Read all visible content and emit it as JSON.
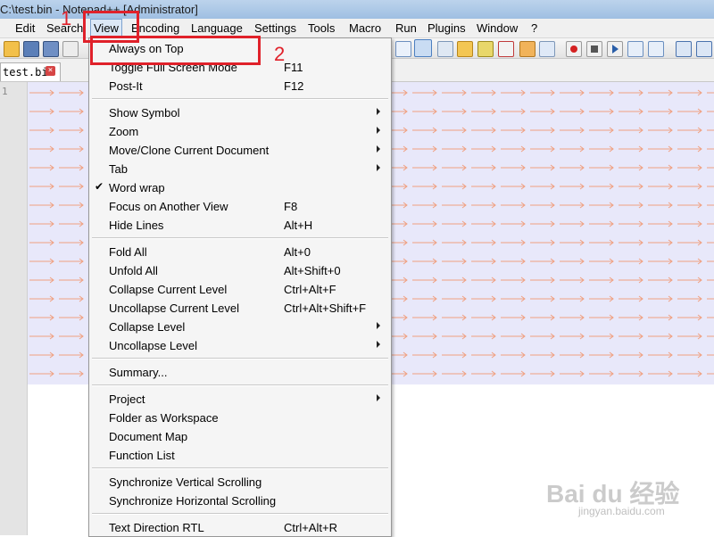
{
  "window": {
    "title": "C:\\test.bin - Notepad++ [Administrator]"
  },
  "menubar": {
    "items": [
      "Edit",
      "Search",
      "View",
      "Encoding",
      "Language",
      "Settings",
      "Tools",
      "Macro",
      "Run",
      "Plugins",
      "Window",
      "?"
    ],
    "active": "View"
  },
  "tab": {
    "label": "test.bin",
    "close": "×"
  },
  "editor": {
    "line_number": "1"
  },
  "view_menu": {
    "always_on_top": "Always on Top",
    "toggle_full_screen": {
      "label": "Toggle Full Screen Mode",
      "shortcut": "F11"
    },
    "post_it": {
      "label": "Post-It",
      "shortcut": "F12"
    },
    "show_symbol": "Show Symbol",
    "zoom": "Zoom",
    "move_clone": "Move/Clone Current Document",
    "tab": "Tab",
    "word_wrap": "Word wrap",
    "check": "✔",
    "focus_view": {
      "label": "Focus on Another View",
      "shortcut": "F8"
    },
    "hide_lines": {
      "label": "Hide Lines",
      "shortcut": "Alt+H"
    },
    "fold_all": {
      "label": "Fold All",
      "shortcut": "Alt+0"
    },
    "unfold_all": {
      "label": "Unfold All",
      "shortcut": "Alt+Shift+0"
    },
    "collapse_current": {
      "label": "Collapse Current Level",
      "shortcut": "Ctrl+Alt+F"
    },
    "uncollapse_current": {
      "label": "Uncollapse Current Level",
      "shortcut": "Ctrl+Alt+Shift+F"
    },
    "collapse_level": "Collapse Level",
    "uncollapse_level": "Uncollapse Level",
    "summary": "Summary...",
    "project": "Project",
    "folder_workspace": "Folder as Workspace",
    "document_map": "Document Map",
    "function_list": "Function List",
    "sync_vertical": "Synchronize Vertical Scrolling",
    "sync_horizontal": "Synchronize Horizontal Scrolling",
    "text_direction": {
      "label": "Text Direction RTL",
      "shortcut": "Ctrl+Alt+R"
    }
  },
  "annotations": {
    "step1": "1",
    "step2": "2"
  },
  "watermark": {
    "brand": "Bai du 经验",
    "url": "jingyan.baidu.com"
  },
  "colors": {
    "annotation": "#e0212a",
    "tab_arrow": "#f0a080",
    "content_bg": "#e8e8fa"
  }
}
